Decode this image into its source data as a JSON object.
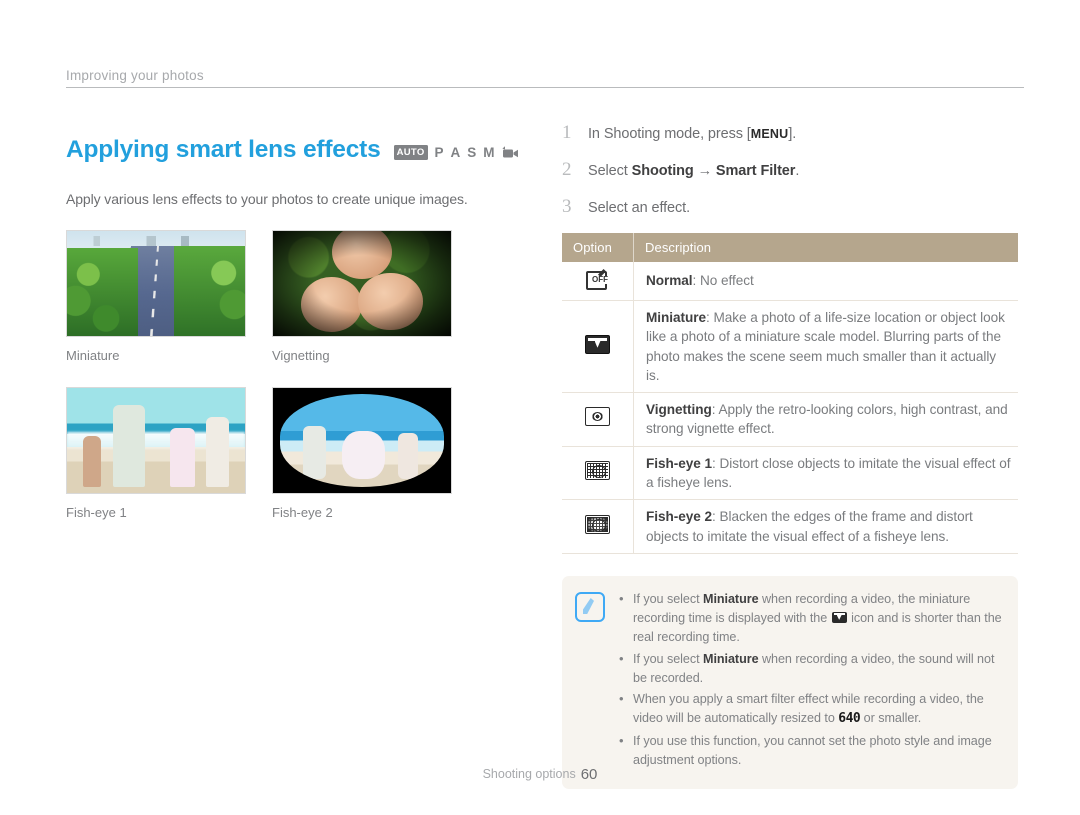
{
  "breadcrumb": "Improving your photos",
  "title": "Applying smart lens effects",
  "mode_icons": {
    "auto": "AUTO",
    "p": "P",
    "a": "A",
    "s": "S",
    "m": "M",
    "video": "video-mode-icon"
  },
  "lede": "Apply various lens effects to your photos to create unique images.",
  "thumbnails": [
    {
      "caption": "Miniature",
      "image": "aerial-highway-with-trees"
    },
    {
      "caption": "Vignetting",
      "image": "three-people-lying-on-grass"
    },
    {
      "caption": "Fish-eye 1",
      "image": "family-running-on-beach"
    },
    {
      "caption": "Fish-eye 2",
      "image": "fisheye-distorted-beach-scene"
    }
  ],
  "steps": [
    {
      "num": "1",
      "pre": "In Shooting mode, press [",
      "kbd": "MENU",
      "post": "]."
    },
    {
      "num": "2",
      "pre": "Select ",
      "bold1": "Shooting",
      "arrow": " → ",
      "bold2": "Smart Filter",
      "post": "."
    },
    {
      "num": "3",
      "pre": "Select an effect.",
      "kbd": "",
      "post": ""
    }
  ],
  "table": {
    "headers": {
      "option": "Option",
      "description": "Description"
    },
    "rows": [
      {
        "icon": "smart-filter-off-icon",
        "name": "Normal",
        "sep": ": ",
        "desc": "No effect"
      },
      {
        "icon": "miniature-icon",
        "name": "Miniature",
        "sep": ": ",
        "desc": "Make a photo of a life-size location or object look like a photo of a miniature scale model. Blurring parts of the photo makes the scene seem much smaller than it actually is."
      },
      {
        "icon": "vignetting-icon",
        "name": "Vignetting",
        "sep": ": ",
        "desc": "Apply the retro-looking colors, high contrast, and strong vignette effect."
      },
      {
        "icon": "fish-eye-1-icon",
        "name": "Fish-eye 1",
        "sep": ": ",
        "desc": "Distort close objects to imitate the visual effect of a fisheye lens."
      },
      {
        "icon": "fish-eye-2-icon",
        "name": "Fish-eye 2",
        "sep": ": ",
        "desc": "Blacken the edges of the frame and distort objects to imitate the visual effect of a fisheye lens."
      }
    ]
  },
  "note": {
    "icon": "note-pen-icon",
    "items": [
      {
        "p1": "If you select ",
        "b1": "Miniature",
        "p2": " when recording a video, the miniature recording time is displayed with the ",
        "inline_icon": "miniature-icon",
        "p3": " icon and is shorter than the real recording time."
      },
      {
        "p1": "If you select ",
        "b1": "Miniature",
        "p2": " when recording a video, the sound will not be recorded.",
        "p3": ""
      },
      {
        "p1": "When you apply a smart filter effect while recording a video, the video will be automatically resized to ",
        "b1": "",
        "glyph": "640",
        "p2": " or smaller.",
        "p3": ""
      },
      {
        "p1": "If you use this function, you cannot set the photo style and image adjustment options.",
        "b1": "",
        "p2": "",
        "p3": ""
      }
    ]
  },
  "footer": {
    "label": "Shooting options",
    "page": "60"
  },
  "colors": {
    "title_blue": "#22a0dd",
    "table_header": "#b5a68d",
    "note_bg": "#f7f4ef",
    "note_icon": "#3fa9f5"
  }
}
